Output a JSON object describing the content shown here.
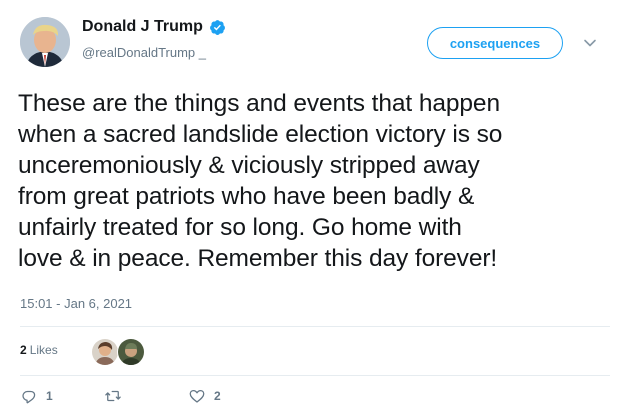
{
  "author": {
    "display_name": "Donald J Trump",
    "handle": "@realDonaldTrump _",
    "verified_icon": "verified-badge-icon"
  },
  "follow_button": {
    "label": "consequences"
  },
  "tweet": {
    "text": "These are the things and events that happen\nwhen a sacred landslide election victory is so\nunceremoniously & viciously stripped away\nfrom great patriots who have been badly &\nunfairly treated for so long. Go home with\nlove & in peace. Remember this day forever!",
    "timestamp": "15:01 - Jan 6, 2021"
  },
  "stats": {
    "likes_count": "2",
    "likes_label": "Likes"
  },
  "actions": {
    "reply_count": "1",
    "retweet_count": "",
    "like_count": "2"
  },
  "colors": {
    "accent": "#1da1f2",
    "text": "#14171a",
    "muted": "#657786",
    "divider": "#e6ecf0"
  }
}
